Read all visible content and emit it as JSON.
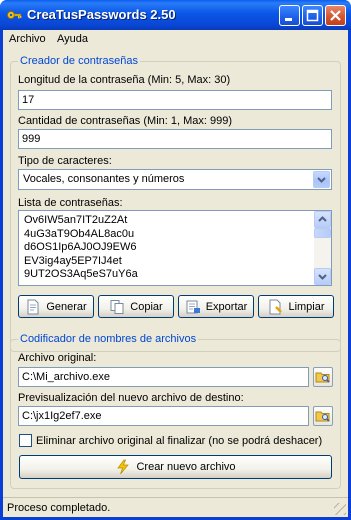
{
  "window": {
    "title": "CreaTusPasswords 2.50",
    "icon": "key-icon"
  },
  "menu": [
    "Archivo",
    "Ayuda"
  ],
  "creator": {
    "group_title": "Creador de contraseñas",
    "length_label": "Longitud de la contraseña (Min: 5, Max: 30)",
    "length_value": "17",
    "count_label": "Cantidad de contraseñas (Min: 1, Max: 999)",
    "count_value": "999",
    "chartype_label": "Tipo de caracteres:",
    "chartype_value": "Vocales, consonantes y números",
    "list_label": "Lista de contraseñas:",
    "passwords": [
      "Ov6IW5an7IT2uZ2At",
      "4uG3aT9Ob4AL8ac0u",
      "d6OS1Ip6AJ0OJ9EW6",
      "EV3ig4ay5EP7IJ4et",
      "9UT2OS3Aq5eS7uY6a"
    ],
    "buttons": {
      "generate": "Generar",
      "copy": "Copiar",
      "export": "Exportar",
      "clear": "Limpiar"
    }
  },
  "encoder": {
    "group_title": "Codificador de nombres de archivos",
    "original_label": "Archivo original:",
    "original_value": "C:\\Mi_archivo.exe",
    "preview_label": "Previsualización del nuevo archivo de destino:",
    "preview_value": "C:\\jx1Ig2ef7.exe",
    "delete_label": "Eliminar archivo original al finalizar (no se podrá deshacer)",
    "delete_checked": false,
    "create_button": "Crear nuevo archivo"
  },
  "status": "Proceso completado.",
  "colors": {
    "titlebar": "#0a56e6",
    "group_title": "#0046d5",
    "window_bg": "#ece9d8"
  }
}
